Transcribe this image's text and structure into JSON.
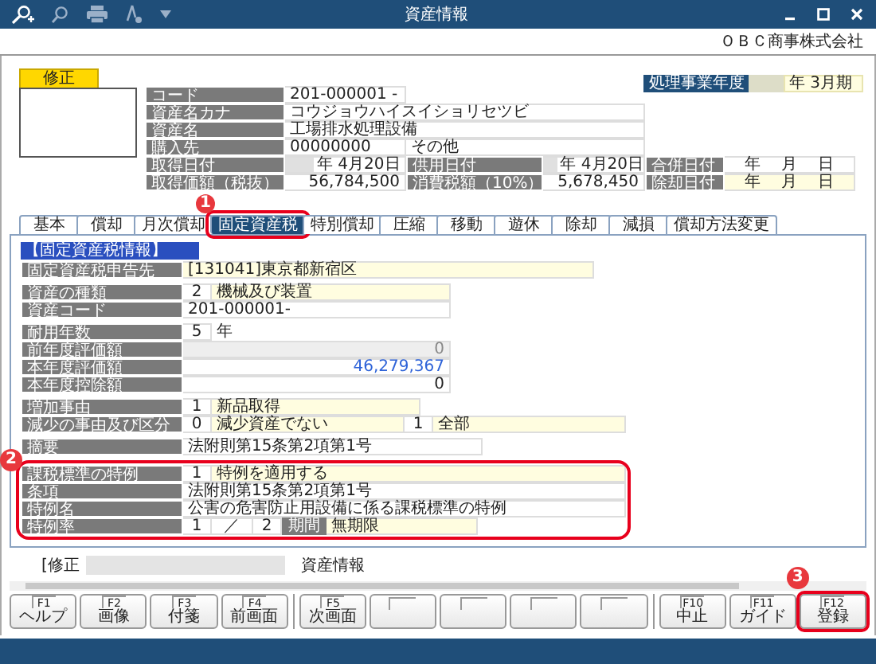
{
  "window": {
    "title": "資産情報"
  },
  "company": "ＯＢＣ商事株式会社",
  "mode_badge": "修正",
  "fiscal_year": {
    "label": "処理事業年度",
    "value": "年  3月期"
  },
  "record": {
    "code": {
      "label": "コード",
      "value": "201-000001 -"
    },
    "kana": {
      "label": "資産名カナ",
      "value": "コウジョウハイスイショリセツビ"
    },
    "name": {
      "label": "資産名",
      "value": "工場排水処理設備"
    },
    "supplier": {
      "label": "購入先",
      "code": "00000000",
      "name": "その他"
    },
    "rows": [
      [
        {
          "label": "取得日付",
          "value": "年  4月20日",
          "kind": "era_date"
        },
        {
          "label": "供用日付",
          "value": "年  4月20日",
          "kind": "era_date"
        },
        {
          "label": "合併日付",
          "value": "年　 月　 日",
          "kind": "date"
        }
      ],
      [
        {
          "label": "取得価額（税抜）",
          "value": "56,784,500",
          "kind": "amount"
        },
        {
          "label": "消費税額（10%）",
          "value": "5,678,450",
          "kind": "amount"
        },
        {
          "label": "除却日付",
          "value": "年　 月　 日",
          "kind": "input_date"
        }
      ]
    ]
  },
  "tabs": [
    {
      "label": "基本",
      "selected": false
    },
    {
      "label": "償却",
      "selected": false
    },
    {
      "label": "月次償却",
      "selected": false
    },
    {
      "label": "固定資産税",
      "selected": true,
      "callout": "1"
    },
    {
      "label": "特別償却",
      "selected": false
    },
    {
      "label": "圧縮",
      "selected": false
    },
    {
      "label": "移動",
      "selected": false
    },
    {
      "label": "遊休",
      "selected": false
    },
    {
      "label": "除却",
      "selected": false
    },
    {
      "label": "減損",
      "selected": false
    },
    {
      "label": "償却方法変更",
      "selected": false
    }
  ],
  "panel": {
    "section_title": "【固定資産税情報】",
    "groups": [
      {
        "rows": [
          {
            "label": "固定資産税申告先",
            "cells": [
              {
                "kind": "choice",
                "text": "[131041]東京都新宿区"
              }
            ]
          }
        ]
      },
      {
        "rows": [
          {
            "label": "資産の種類",
            "cells": [
              {
                "kind": "num",
                "text": "2"
              },
              {
                "kind": "choice",
                "text": "機械及び装置"
              }
            ]
          },
          {
            "label": "資産コード",
            "cells": [
              {
                "kind": "text",
                "text": "201-000001-"
              }
            ]
          }
        ]
      },
      {
        "rows": [
          {
            "label": "耐用年数",
            "cells": [
              {
                "kind": "num",
                "text": "5"
              },
              {
                "kind": "unit",
                "text": "年"
              }
            ]
          },
          {
            "label": "前年度評価額",
            "cells": [
              {
                "kind": "locked",
                "text": "0"
              }
            ]
          },
          {
            "label": "本年度評価額",
            "cells": [
              {
                "kind": "calc",
                "text": "46,279,367"
              }
            ]
          },
          {
            "label": "本年度控除額",
            "cells": [
              {
                "kind": "amount",
                "text": "0"
              }
            ]
          }
        ]
      },
      {
        "rows": [
          {
            "label": "増加事由",
            "cells": [
              {
                "kind": "num",
                "text": "1"
              },
              {
                "kind": "choice",
                "text": "新品取得"
              },
              {
                "kind": "gap",
                "text": ""
              }
            ]
          },
          {
            "label": "減少の事由及び区分",
            "cells": [
              {
                "kind": "num",
                "text": "0"
              },
              {
                "kind": "choice",
                "text": "減少資産でない"
              },
              {
                "kind": "num",
                "text": "1"
              },
              {
                "kind": "choice",
                "text": "全部"
              }
            ]
          }
        ]
      },
      {
        "rows": [
          {
            "label": "摘要",
            "cells": [
              {
                "kind": "text",
                "text": "法附則第15条第2項第1号"
              }
            ]
          }
        ]
      },
      {
        "callout": "2",
        "rows": [
          {
            "label": "課税標準の特例",
            "cells": [
              {
                "kind": "num",
                "text": "1"
              },
              {
                "kind": "choice",
                "text": "特例を適用する"
              }
            ]
          },
          {
            "label": "条項",
            "cells": [
              {
                "kind": "text",
                "text": "法附則第15条第2項第1号"
              }
            ]
          },
          {
            "label": "特例名",
            "cells": [
              {
                "kind": "text",
                "text": "公害の危害防止用設備に係る課税標準の特例"
              }
            ]
          },
          {
            "label": "特例率",
            "cells": [
              {
                "kind": "num",
                "text": "1"
              },
              {
                "kind": "sep",
                "text": "／"
              },
              {
                "kind": "num",
                "text": "2"
              },
              {
                "kind": "tag",
                "text": "期間"
              },
              {
                "kind": "choice",
                "text": "無期限"
              },
              {
                "kind": "gap",
                "text": ""
              }
            ]
          }
        ]
      }
    ]
  },
  "status": {
    "mode": "[修正",
    "screen": "資産情報"
  },
  "function_keys": [
    {
      "key": "F1",
      "label": "ヘルプ"
    },
    {
      "key": "F2",
      "label": "画像"
    },
    {
      "key": "F3",
      "label": "付箋"
    },
    {
      "key": "F4",
      "label": "前画面"
    },
    {
      "key": "F5",
      "label": "次画面"
    },
    {
      "kind": "blank"
    },
    {
      "kind": "blank"
    },
    {
      "kind": "blank"
    },
    {
      "kind": "blank"
    },
    {
      "key": "F10",
      "label": "中止"
    },
    {
      "key": "F11",
      "label": "ガイド"
    },
    {
      "key": "F12",
      "label": "登録",
      "callout": "3"
    }
  ]
}
